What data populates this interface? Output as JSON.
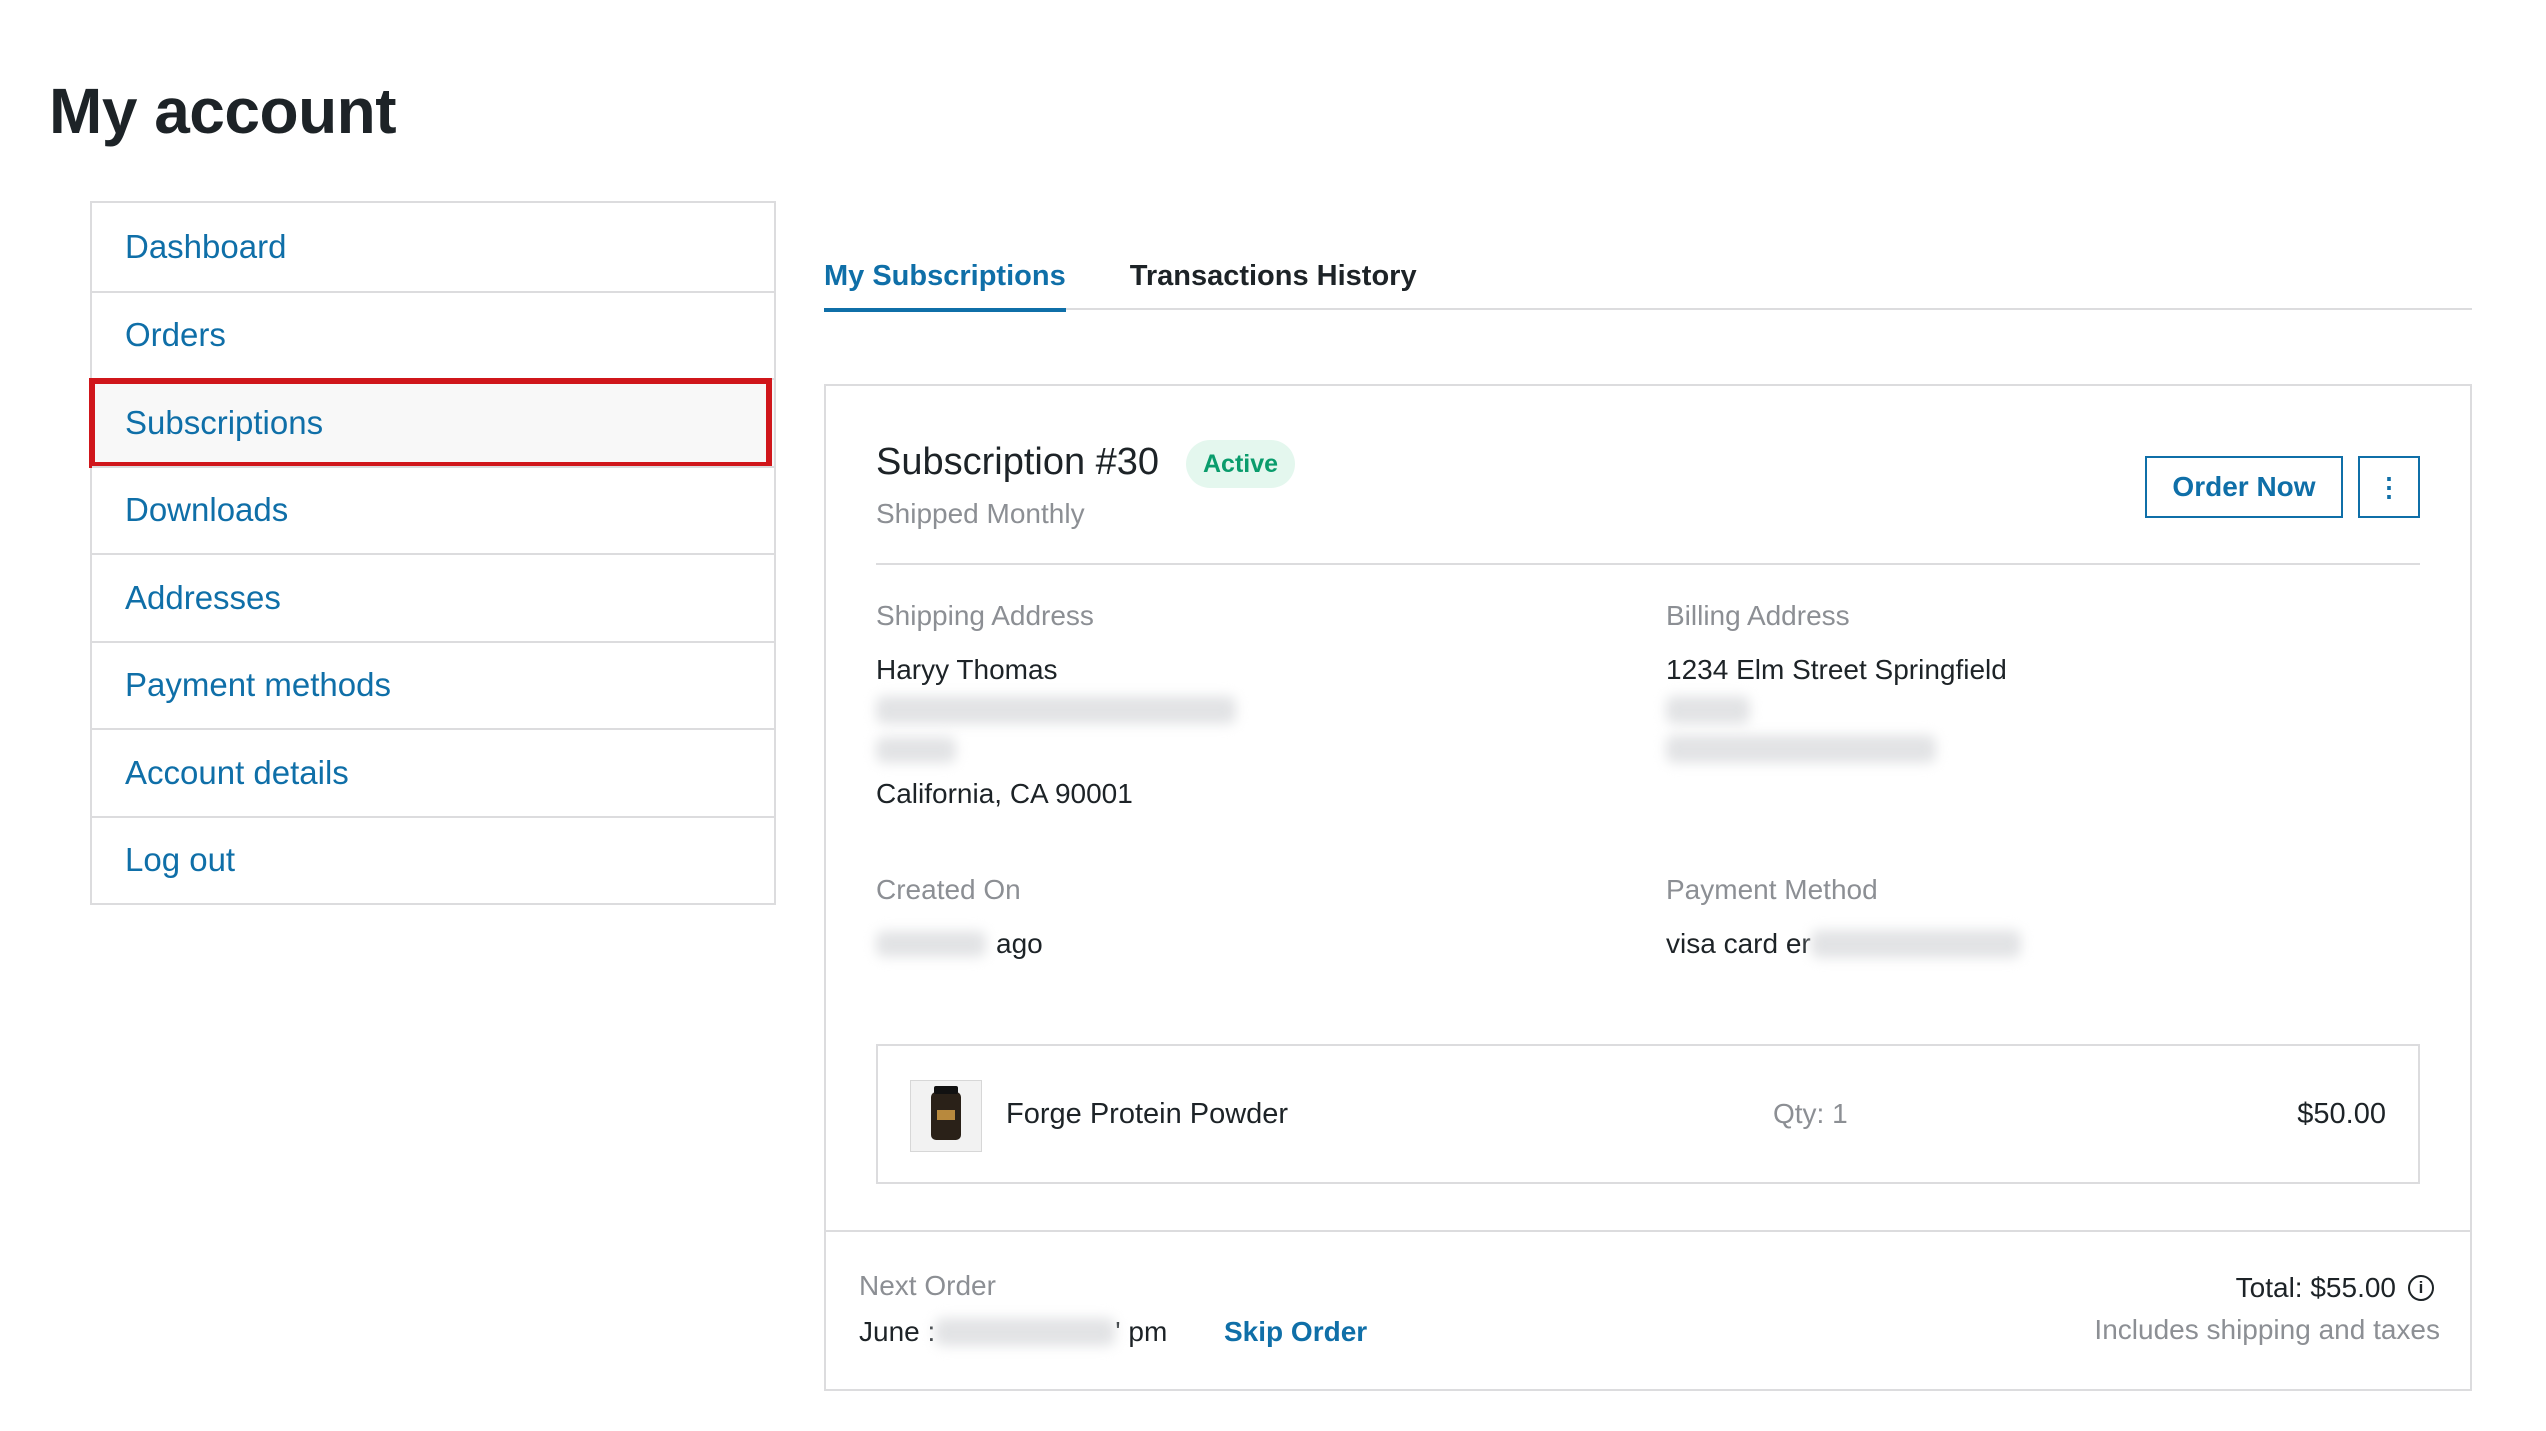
{
  "page": {
    "title": "My account"
  },
  "sidebar": {
    "items": [
      {
        "label": "Dashboard"
      },
      {
        "label": "Orders"
      },
      {
        "label": "Subscriptions"
      },
      {
        "label": "Downloads"
      },
      {
        "label": "Addresses"
      },
      {
        "label": "Payment methods"
      },
      {
        "label": "Account details"
      },
      {
        "label": "Log out"
      }
    ],
    "active_index": 2
  },
  "tabs": [
    {
      "label": "My Subscriptions"
    },
    {
      "label": "Transactions History"
    }
  ],
  "subscription": {
    "title": "Subscription #30",
    "status": "Active",
    "frequency": "Shipped Monthly",
    "order_now_label": "Order Now",
    "more_icon": "⋮",
    "shipping": {
      "label": "Shipping Address",
      "name": "Haryy Thomas",
      "city_line": "California, CA 90001"
    },
    "billing": {
      "label": "Billing Address",
      "line1": "1234 Elm Street Springfield"
    },
    "created": {
      "label": "Created On",
      "value_suffix": "ago"
    },
    "payment": {
      "label": "Payment Method",
      "value_prefix": "visa card er"
    },
    "product": {
      "name": "Forge Protein Powder",
      "qty": "Qty: 1",
      "price": "$50.00"
    },
    "next_order": {
      "label": "Next Order",
      "prefix": "June :",
      "suffix": "' pm",
      "skip_label": "Skip Order"
    },
    "total": {
      "label": "Total: $55.00",
      "note": "Includes shipping and taxes",
      "info_icon": "i"
    }
  },
  "colors": {
    "link": "#0f6fa8",
    "highlight": "#d0161b",
    "status_bg": "#e4f7ee",
    "status_text": "#0a9c6c"
  }
}
